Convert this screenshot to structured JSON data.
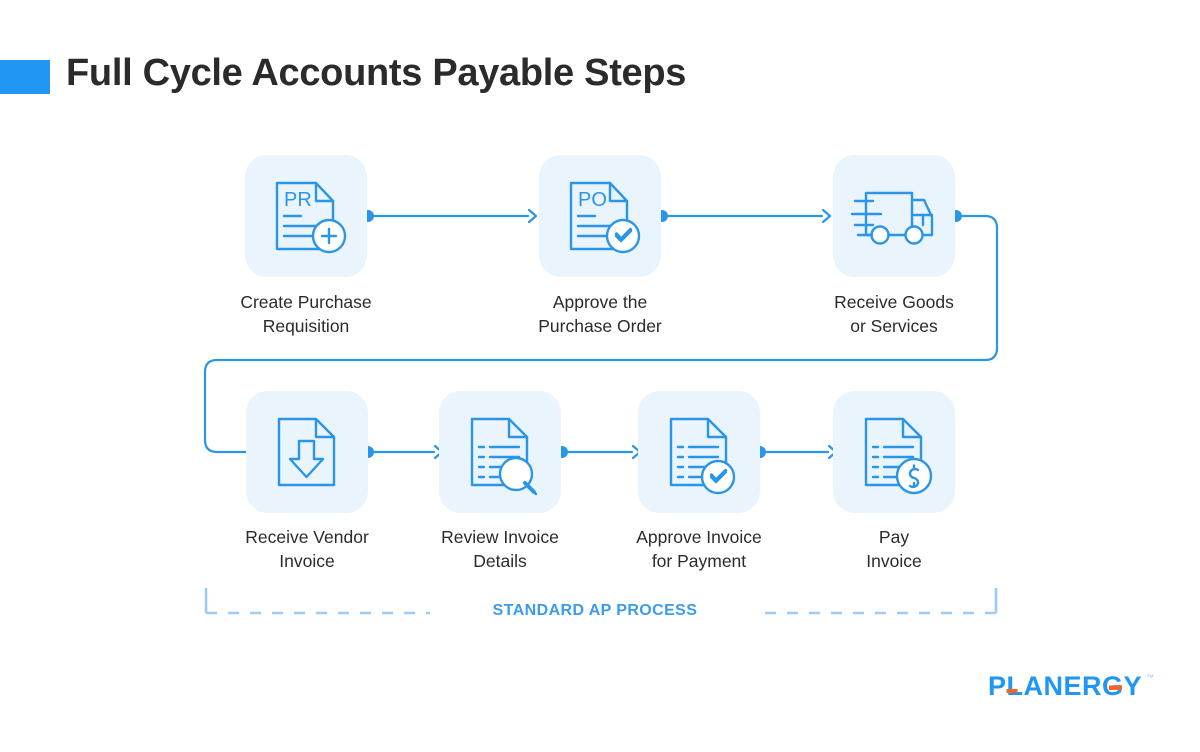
{
  "header": {
    "title": "Full Cycle Accounts Payable Steps",
    "accent_color": "#2196f3"
  },
  "theme": {
    "accent": "#2196f3",
    "line": "#2b95e8",
    "tile_bg": "#e9f4fd",
    "dash": "#9ccbf5",
    "text": "#2b2b2b",
    "logo_blue": "#2196f3",
    "logo_orange": "#f26522"
  },
  "flow": {
    "row1": [
      {
        "id": "step-1",
        "icon": "document-pr-add-icon",
        "badge": "plus-badge",
        "doc_label": "PR",
        "line1": "Create Purchase",
        "line2": "Requisition"
      },
      {
        "id": "step-2",
        "icon": "document-po-check-icon",
        "badge": "check-badge",
        "doc_label": "PO",
        "line1": "Approve the",
        "line2": "Purchase Order"
      },
      {
        "id": "step-3",
        "icon": "delivery-truck-icon",
        "badge": "",
        "doc_label": "",
        "line1": "Receive Goods",
        "line2": "or Services"
      }
    ],
    "row2": [
      {
        "id": "step-4",
        "icon": "document-download-icon",
        "badge": "",
        "doc_label": "",
        "line1": "Receive Vendor",
        "line2": "Invoice"
      },
      {
        "id": "step-5",
        "icon": "document-search-icon",
        "badge": "magnifier-badge",
        "doc_label": "",
        "line1": "Review Invoice",
        "line2": "Details"
      },
      {
        "id": "step-6",
        "icon": "document-approve-icon",
        "badge": "check-badge",
        "doc_label": "",
        "line1": "Approve Invoice",
        "line2": "for Payment"
      },
      {
        "id": "step-7",
        "icon": "document-dollar-icon",
        "badge": "dollar-badge",
        "doc_label": "",
        "line1": "Pay",
        "line2": "Invoice"
      }
    ]
  },
  "bracket": {
    "label": "STANDARD AP PROCESS"
  },
  "logo": {
    "text": "PLANERGY",
    "trademark": "™"
  }
}
